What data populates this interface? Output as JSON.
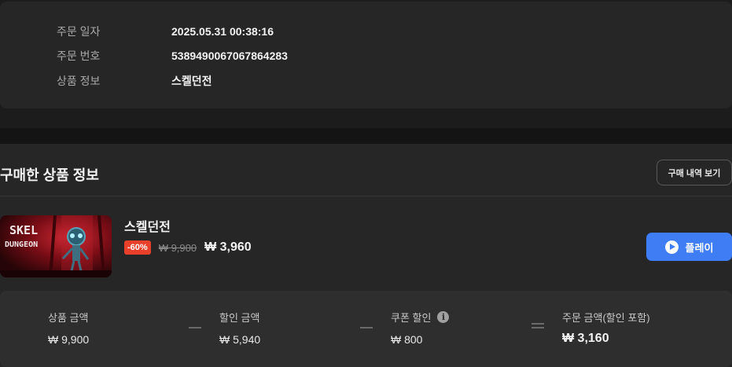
{
  "order_info": {
    "date_label": "주문 일자",
    "date_value": "2025.05.31 00:38:16",
    "number_label": "주문 번호",
    "number_value": "5389490067067864283",
    "product_label": "상품 정보",
    "product_value": "스켈던전"
  },
  "purchase": {
    "section_title": "구매한 상품 정보",
    "history_button": "구매 내역 보기",
    "product": {
      "thumbnail_text_line1": "SKEL",
      "thumbnail_text_line2": "DUNGEON",
      "name": "스켈던전",
      "discount_badge": "-60%",
      "original_price": "₩ 9,900",
      "sale_price": "₩ 3,960",
      "play_button": "플레이",
      "play_icon": "play-circle-icon"
    }
  },
  "summary": {
    "product_amount_label": "상품 금액",
    "product_amount_value": "₩ 9,900",
    "discount_amount_label": "할인 금액",
    "discount_amount_value": "₩ 5,940",
    "coupon_label": "쿠폰 할인",
    "coupon_value": "₩ 800",
    "coupon_info_icon": "info-icon",
    "total_label": "주문 금액(할인 포함)",
    "total_value": "₩ 3,160"
  },
  "colors": {
    "accent": "#3f7df5",
    "discount": "#e8402a",
    "card_bg": "#262626",
    "page_bg": "#1c1c1c"
  }
}
